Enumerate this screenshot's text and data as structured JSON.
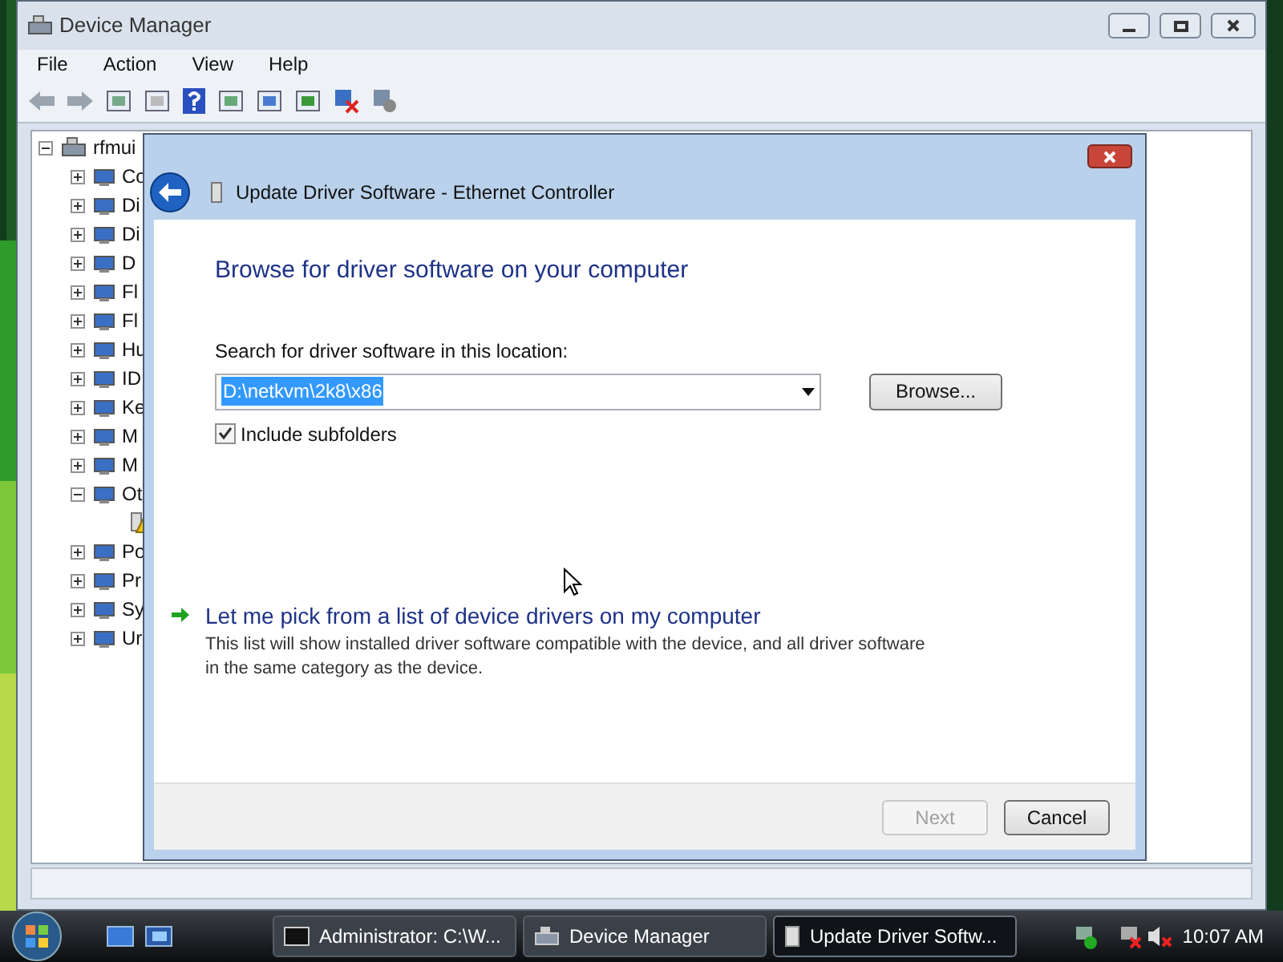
{
  "window": {
    "title": "Device Manager"
  },
  "menu": [
    "File",
    "Action",
    "View",
    "Help"
  ],
  "tree": {
    "label": "rfmui",
    "expanded": true,
    "children": [
      {
        "label": "Co",
        "expanded": false
      },
      {
        "label": "Di",
        "expanded": false
      },
      {
        "label": "Di",
        "expanded": false
      },
      {
        "label": "D",
        "expanded": false
      },
      {
        "label": "Fl",
        "expanded": false
      },
      {
        "label": "Fl",
        "expanded": false
      },
      {
        "label": "Hu",
        "expanded": false
      },
      {
        "label": "ID",
        "expanded": false
      },
      {
        "label": "Ke",
        "expanded": false
      },
      {
        "label": "M",
        "expanded": false
      },
      {
        "label": "M",
        "expanded": false
      },
      {
        "label": "Ot",
        "expanded": true,
        "children": [
          {
            "warning": true
          }
        ]
      },
      {
        "label": "Po",
        "expanded": false
      },
      {
        "label": "Pr",
        "expanded": false
      },
      {
        "label": "Sy",
        "expanded": false
      },
      {
        "label": "Ur",
        "expanded": false
      }
    ]
  },
  "dialog": {
    "title": "Update Driver Software - Ethernet Controller",
    "heading": "Browse for driver software on your computer",
    "location_label": "Search for driver software in this location:",
    "location_value": "D:\\netkvm\\2k8\\x86",
    "browse_button": "Browse...",
    "include_subfolders": {
      "label": "Include subfolders",
      "checked": true
    },
    "option": {
      "title": "Let me pick from a list of device drivers on my computer",
      "description": "This list will show installed driver software compatible with the device, and all driver software in the same category as the device."
    },
    "buttons": [
      {
        "label": "Next",
        "disabled": true
      },
      {
        "label": "Cancel",
        "disabled": false
      }
    ]
  },
  "taskbar": {
    "tasks": [
      {
        "label": "Administrator: C:\\W...",
        "kind": "console",
        "selected": false
      },
      {
        "label": "Device Manager",
        "kind": "manager",
        "selected": false
      },
      {
        "label": "Update Driver Softw...",
        "kind": "driver",
        "selected": true
      }
    ],
    "clock": "10:07 AM"
  }
}
